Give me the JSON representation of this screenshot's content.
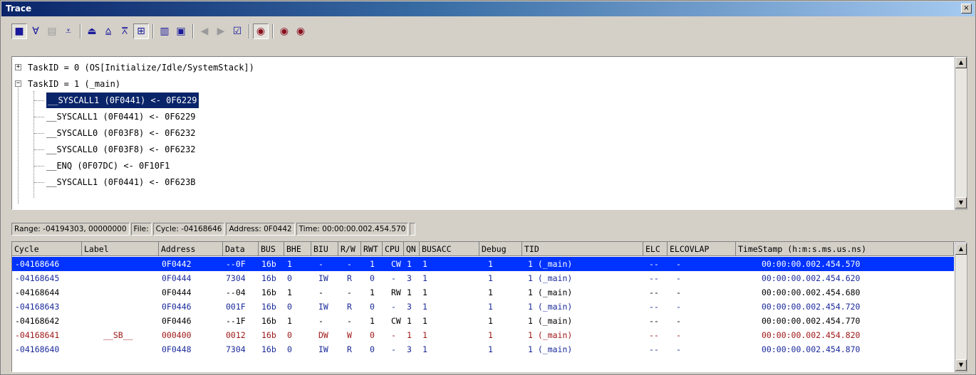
{
  "window": {
    "title": "Trace",
    "close_glyph": "×"
  },
  "toolbar": {
    "buttons": [
      {
        "name": "display-mode-icon",
        "glyph": "■"
      },
      {
        "name": "filter-icon",
        "glyph": "∀"
      },
      {
        "name": "copy-icon",
        "glyph": "▤"
      },
      {
        "name": "collapse-all-icon",
        "glyph": "⩡"
      },
      {
        "name": "expand-icon",
        "glyph": "⏏"
      },
      {
        "name": "collapse-icon",
        "glyph": "⩠"
      },
      {
        "name": "minimize-icon",
        "glyph": "⩞"
      },
      {
        "name": "tree-view-icon",
        "glyph": "⊞"
      },
      {
        "name": "list-view-icon",
        "glyph": "▥"
      },
      {
        "name": "window-icon",
        "glyph": "▣"
      },
      {
        "name": "prev-icon",
        "glyph": "◀"
      },
      {
        "name": "next-icon",
        "glyph": "▶"
      },
      {
        "name": "properties-icon",
        "glyph": "☑"
      },
      {
        "name": "find-icon",
        "glyph": "◉"
      },
      {
        "name": "find-next-icon",
        "glyph": "◉"
      },
      {
        "name": "find-prev-icon",
        "glyph": "◉"
      }
    ]
  },
  "tree": {
    "nodes": [
      {
        "label": "TaskID = 0 (OS[Initialize/Idle/SystemStack])",
        "expander": "+"
      },
      {
        "label": "TaskID = 1 (_main)",
        "expander": "−"
      }
    ],
    "children": [
      "__SYSCALL1 (0F0441) <- 0F6229",
      "__SYSCALL1 (0F0441) <- 0F6229",
      "__SYSCALL0 (0F03F8) <- 0F6232",
      "__SYSCALL0 (0F03F8) <- 0F6232",
      "__ENQ (0F07DC) <- 0F10F1",
      "__SYSCALL1 (0F0441) <- 0F623B"
    ]
  },
  "infobar": {
    "range": "Range: -04194303, 00000000",
    "file": "File:",
    "cycle": "Cycle: -04168646",
    "address": "Address: 0F0442",
    "time": "Time: 00:00:00.002.454.570"
  },
  "table": {
    "headers": [
      "Cycle",
      "Label",
      "Address",
      "Data",
      "BUS",
      "BHE",
      "BIU",
      "R/W",
      "RWT",
      "CPU",
      "QN",
      "BUSACC",
      "Debug",
      "TID",
      "ELC",
      "ELCOVLAP",
      "TimeStamp (h:m:s.ms.us.ns)"
    ],
    "rows": [
      {
        "style": "selected",
        "cells": [
          "-04168646",
          "",
          "0F0442",
          "--0F",
          "16b",
          "1",
          "-",
          "-",
          "1",
          "CW",
          "1",
          "1",
          "1",
          "1 (_main)",
          "--",
          "-",
          "00:00:00.002.454.570"
        ]
      },
      {
        "style": "blue",
        "cells": [
          "-04168645",
          "",
          "0F0444",
          "7304",
          "16b",
          "0",
          "IW",
          "R",
          "0",
          "-",
          "3",
          "1",
          "1",
          "1 (_main)",
          "--",
          "-",
          "00:00:00.002.454.620"
        ]
      },
      {
        "style": "black",
        "cells": [
          "-04168644",
          "",
          "0F0444",
          "--04",
          "16b",
          "1",
          "-",
          "-",
          "1",
          "RW",
          "1",
          "1",
          "1",
          "1 (_main)",
          "--",
          "-",
          "00:00:00.002.454.680"
        ]
      },
      {
        "style": "blue",
        "cells": [
          "-04168643",
          "",
          "0F0446",
          "001F",
          "16b",
          "0",
          "IW",
          "R",
          "0",
          "-",
          "3",
          "1",
          "1",
          "1 (_main)",
          "--",
          "-",
          "00:00:00.002.454.720"
        ]
      },
      {
        "style": "black",
        "cells": [
          "-04168642",
          "",
          "0F0446",
          "--1F",
          "16b",
          "1",
          "-",
          "-",
          "1",
          "CW",
          "1",
          "1",
          "1",
          "1 (_main)",
          "--",
          "-",
          "00:00:00.002.454.770"
        ]
      },
      {
        "style": "red",
        "cells": [
          "-04168641",
          "__SB__",
          "000400",
          "0012",
          "16b",
          "0",
          "DW",
          "W",
          "0",
          "-",
          "1",
          "1",
          "1",
          "1 (_main)",
          "--",
          "-",
          "00:00:00.002.454.820"
        ]
      },
      {
        "style": "blue",
        "cells": [
          "-04168640",
          "",
          "0F0448",
          "7304",
          "16b",
          "0",
          "IW",
          "R",
          "0",
          "-",
          "3",
          "1",
          "1",
          "1 (_main)",
          "--",
          "-",
          "00:00:00.002.454.870"
        ]
      }
    ]
  }
}
